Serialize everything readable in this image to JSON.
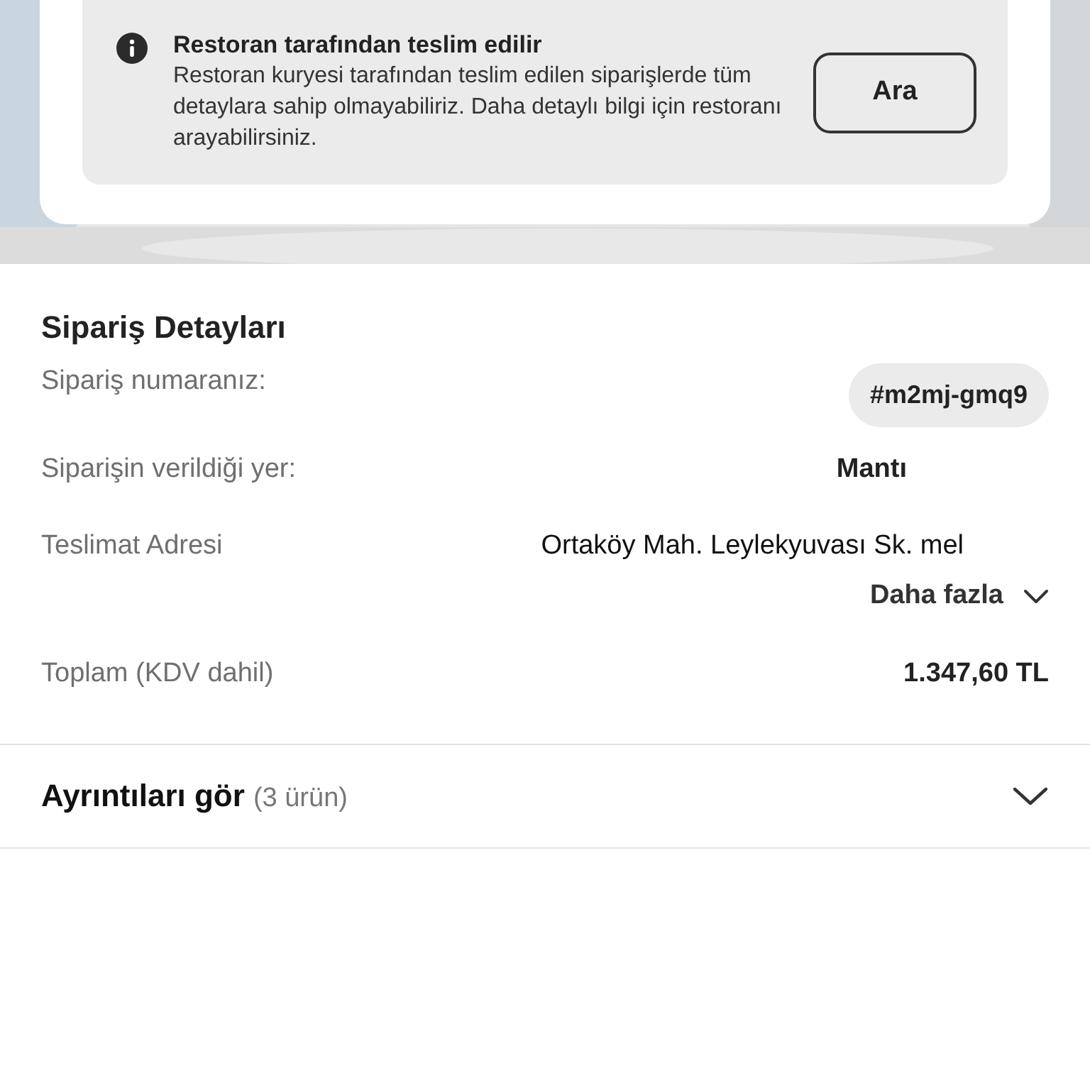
{
  "notice": {
    "title": "Restoran tarafından teslim edilir",
    "body": "Restoran kuryesi tarafından teslim edilen siparişlerde tüm detaylara sahip olmayabiliriz. Daha detaylı bilgi için restoranı arayabilirsiniz.",
    "button": "Ara"
  },
  "order_details": {
    "heading": "Sipariş Detayları",
    "rows": [
      {
        "kind": "badge",
        "label": "Sipariş numaranız:",
        "value": "#m2mj-gmq9"
      },
      {
        "kind": "text",
        "label": "Siparişin verildiği yer:",
        "value": "Mantı"
      },
      {
        "kind": "address",
        "label": "Teslimat Adresi",
        "value": "Ortaköy Mah. Leylekyuvası Sk. mel",
        "more": "Daha fazla"
      },
      {
        "kind": "text",
        "label": "Toplam (KDV dahil)",
        "value": "1.347,60 TL"
      }
    ]
  },
  "items_section": {
    "title": "Ayrıntıları gör",
    "count": "(3 ürün)",
    "expanded": false
  }
}
